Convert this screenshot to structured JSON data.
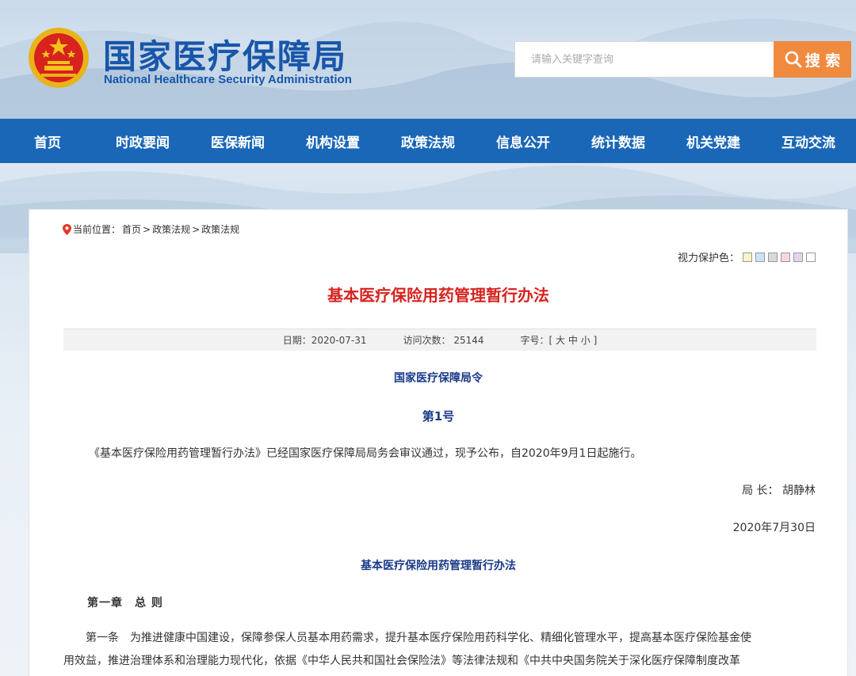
{
  "header": {
    "title": "国家医疗保障局",
    "subtitle": "National Healthcare Security Administration",
    "emblem_icon": "national-emblem-icon",
    "brand_color": "#1756a9"
  },
  "search": {
    "placeholder": "请输入关键字查询",
    "button_label": "搜 索",
    "button_color": "#f08a3e"
  },
  "nav": {
    "color": "#1a67b8",
    "items": [
      {
        "label": "首页"
      },
      {
        "label": "时政要闻"
      },
      {
        "label": "医保新闻"
      },
      {
        "label": "机构设置"
      },
      {
        "label": "政策法规"
      },
      {
        "label": "信息公开"
      },
      {
        "label": "统计数据"
      },
      {
        "label": "机关党建"
      },
      {
        "label": "互动交流"
      }
    ]
  },
  "breadcrumb": {
    "prefix": "当前位置：",
    "items": [
      "首页",
      "政策法规",
      "政策法规"
    ],
    "separator": ">"
  },
  "eye_care": {
    "label": "视力保护色：",
    "swatches": [
      "#f7f4c6",
      "#c8e6f2",
      "#d9d9d9",
      "#f6d6de",
      "#e3d3f1",
      "#ffffff"
    ]
  },
  "article": {
    "title": "基本医疗保险用药管理暂行办法",
    "title_color": "#d7221e",
    "date_label": "日期：2020-07-31",
    "visits_label": "访问次数：",
    "visits": "25144",
    "fontsize_label": "字号：[",
    "fontsize_large": "大",
    "fontsize_medium": "中",
    "fontsize_small": "小",
    "fontsize_close": "]",
    "order_title": "国家医疗保障局令",
    "order_number": "第1号",
    "intro": "《基本医疗保险用药管理暂行办法》已经国家医疗保障局局务会审议通过，现予公布，自2020年9月1日起施行。",
    "director": "局 长：  胡静林",
    "sign_date": "2020年7月30日",
    "sub_title": "基本医疗保险用药管理暂行办法",
    "chapter": "第一章　总 则",
    "article1_line1": "　　第一条　为推进健康中国建设，保障参保人员基本用药需求，提升基本医疗保险用药科学化、精细化管理水平，提高基本医疗保险基金使",
    "article1_line2": "用效益，推进治理体系和治理能力现代化，依据《中华人民共和国社会保险法》等法律法规和《中共中央国务院关于深化医疗保障制度改革"
  }
}
